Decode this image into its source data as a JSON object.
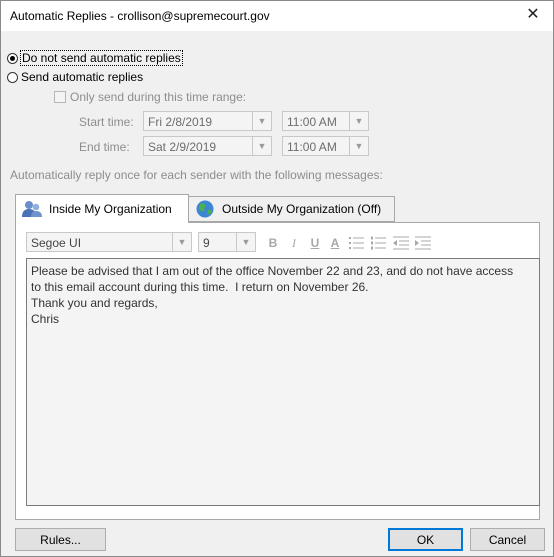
{
  "window": {
    "title": "Automatic Replies - crollison@supremecourt.gov",
    "close_symbol": "✕"
  },
  "options": {
    "do_not_send_label": "Do not send automatic replies",
    "do_not_send_checked": true,
    "send_label": "Send automatic replies",
    "send_checked": false,
    "time_range_label": "Only send during this time range:",
    "time_range_checked": false
  },
  "schedule": {
    "start_label": "Start time:",
    "start_date": "Fri 2/8/2019",
    "start_time": "11:00 AM",
    "end_label": "End time:",
    "end_date": "Sat 2/9/2019",
    "end_time": "11:00 AM"
  },
  "instruction": "Automatically reply once for each sender with the following messages:",
  "tabs": [
    {
      "label": "Inside My Organization",
      "active": true,
      "icon": "people-icon"
    },
    {
      "label": "Outside My Organization (Off)",
      "active": false,
      "icon": "globe-icon"
    }
  ],
  "toolbar": {
    "font_name": "Segoe UI",
    "font_size": "9",
    "bold": "B",
    "italic": "I",
    "underline": "U",
    "font_color": "A",
    "bullets_icon": "bullet-list-icon",
    "numbering_icon": "numbered-list-icon",
    "decrease_indent_icon": "decrease-indent-icon",
    "increase_indent_icon": "increase-indent-icon"
  },
  "message": {
    "line1": "Please be advised that I am out of the office November 22 and 23, and do not have access",
    "line2": "to this email account during this time.  I return on November 26.",
    "line3": "",
    "line4": "Thank you and regards,",
    "line5": "Chris"
  },
  "buttons": {
    "rules": "Rules...",
    "ok": "OK",
    "cancel": "Cancel"
  },
  "colors": {
    "ok_border": "#0078d7",
    "disabled_text": "#8d8d8d"
  }
}
